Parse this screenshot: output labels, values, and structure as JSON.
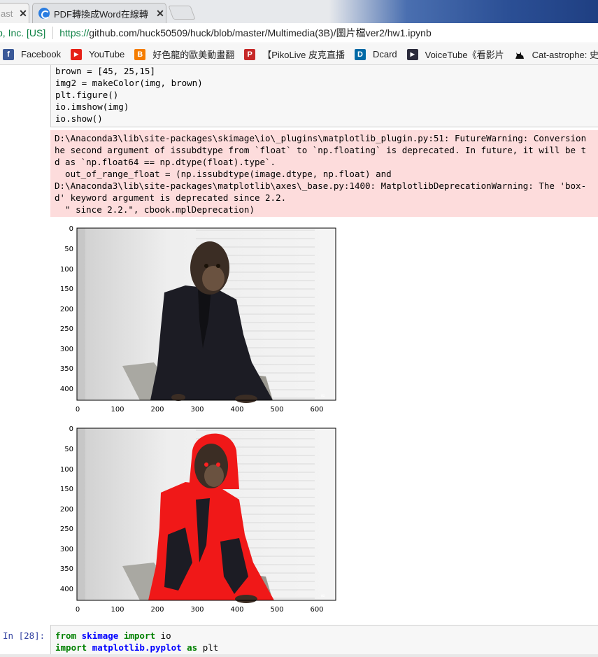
{
  "browser": {
    "tabs": [
      {
        "label": "ast",
        "active": false
      },
      {
        "label": "PDF轉換成Word在線轉",
        "active": true
      }
    ],
    "close_glyph": "✕",
    "address": {
      "ev_label": "b, Inc. [US]",
      "url_https": "https://",
      "url_rest": "github.com/huck50509/huck/blob/master/Multimedia(3B)/圖片檔ver2/hw1.ipynb"
    },
    "bookmarks": [
      {
        "label": "Facebook",
        "icon": "facebook-icon",
        "color": "#3b5998",
        "glyph": "f"
      },
      {
        "label": "YouTube",
        "icon": "youtube-icon",
        "color": "#e62117",
        "glyph": "▶"
      },
      {
        "label": "好色龍的歐美動畫翻",
        "icon": "blogger-icon",
        "color": "#f57d00",
        "glyph": "B"
      },
      {
        "label": "【PikoLive 皮克直播",
        "icon": "pikolive-icon",
        "color": "#c62828",
        "glyph": "P"
      },
      {
        "label": "Dcard",
        "icon": "dcard-icon",
        "color": "#006aa6",
        "glyph": "D"
      },
      {
        "label": "VoiceTube《看影片",
        "icon": "voicetube-icon",
        "color": "#2b2b3b",
        "glyph": "▶"
      },
      {
        "label": "Cat-astrophe: 史帝",
        "icon": "cat-icon",
        "color": "#ffffff",
        "glyph": "🐈"
      }
    ]
  },
  "notebook": {
    "code_top_lines": [
      "brown = [45, 25,15]",
      "img2 = makeColor(img, brown)",
      "plt.figure()",
      "io.imshow(img)",
      "io.show()"
    ],
    "stderr_lines": [
      "D:\\Anaconda3\\lib\\site-packages\\skimage\\io\\_plugins\\matplotlib_plugin.py:51: FutureWarning: Conversion",
      "he second argument of issubdtype from `float` to `np.floating` is deprecated. In future, it will be t",
      "d as `np.float64 == np.dtype(float).type`.",
      "  out_of_range_float = (np.issubdtype(image.dtype, np.float) and",
      "D:\\Anaconda3\\lib\\site-packages\\matplotlib\\axes\\_base.py:1400: MatplotlibDeprecationWarning: The 'box-",
      "d' keyword argument is deprecated since 2.2.",
      "  \" since 2.2.\", cbook.mplDeprecation)"
    ],
    "figures": [
      {
        "name": "original-image",
        "y_ticks": [
          "0",
          "50",
          "100",
          "150",
          "200",
          "250",
          "300",
          "350",
          "400"
        ],
        "x_ticks": [
          "0",
          "100",
          "200",
          "300",
          "400",
          "500",
          "600"
        ],
        "suit_color": "#1c1c24",
        "accent": "#1c1c24"
      },
      {
        "name": "recolored-image",
        "y_ticks": [
          "0",
          "50",
          "100",
          "150",
          "200",
          "250",
          "300",
          "350",
          "400"
        ],
        "x_ticks": [
          "0",
          "100",
          "200",
          "300",
          "400",
          "500",
          "600"
        ],
        "suit_color": "#f01818",
        "accent": "#1c1c24"
      }
    ],
    "bottom_cell": {
      "prompt": "In [28]:",
      "lines": [
        {
          "kw1": "from",
          "mod": "skimage",
          "kw2": "import",
          "rest": "io"
        },
        {
          "kw1": "import",
          "mod": "matplotlib.pyplot",
          "kw2": "as",
          "rest": "plt"
        }
      ]
    }
  }
}
